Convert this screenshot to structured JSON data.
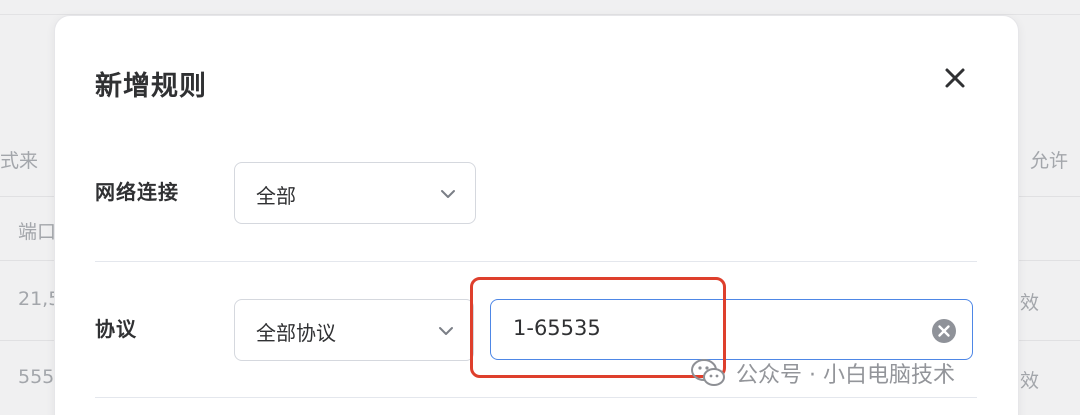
{
  "background": {
    "col_left": "式来",
    "col_right": "允许",
    "row_header": "端口",
    "row1": "21,5",
    "row2": "555",
    "row1_right": "效",
    "row2_right": "效"
  },
  "dialog": {
    "title": "新增规则",
    "close_icon": "close-icon"
  },
  "fields": {
    "network": {
      "label": "网络连接",
      "selected": "全部"
    },
    "protocol": {
      "label": "协议",
      "selected": "全部协议",
      "port_value": "1-65535"
    }
  },
  "watermark": {
    "text": "公众号 · 小白电脑技术"
  },
  "colors": {
    "input_focus": "#4e87e6",
    "highlight": "#de3f2c",
    "title": "#303133"
  }
}
